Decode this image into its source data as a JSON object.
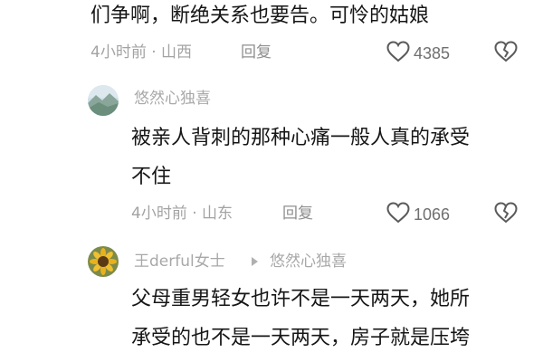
{
  "comments": [
    {
      "text_lines": [
        "们争啊，断绝关系也要告。可怜的姑娘"
      ],
      "time": "4小时前",
      "sep": "·",
      "location": "山西",
      "reply_label": "回复",
      "likes": "4385"
    },
    {
      "username": "悠然心独喜",
      "text_lines": [
        "被亲人背刺的那种心痛一般人真的承受",
        "不住"
      ],
      "time": "4小时前",
      "sep": "·",
      "location": "山东",
      "reply_label": "回复",
      "likes": "1066"
    },
    {
      "username": "王derful女士",
      "reply_to": "悠然心独喜",
      "text_lines": [
        "父母重男轻女也许不是一天两天，她所",
        "承受的也不是一天两天，房子就是压垮"
      ]
    }
  ],
  "colors": {
    "text": "#161616",
    "meta": "#a3a3a3",
    "icon": "#5a5a5a"
  }
}
